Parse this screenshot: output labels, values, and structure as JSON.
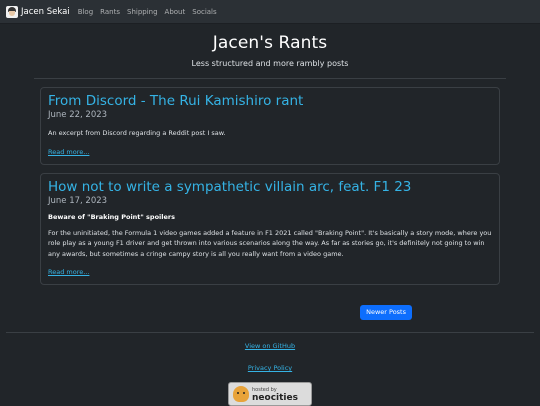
{
  "nav": {
    "brand": "Jacen Sekai",
    "links": [
      "Blog",
      "Rants",
      "Shipping",
      "About",
      "Socials"
    ]
  },
  "header": {
    "title": "Jacen's Rants",
    "subtitle": "Less structured and more rambly posts"
  },
  "posts": [
    {
      "title": "From Discord - The Rui Kamishiro rant",
      "date": "June 22, 2023",
      "excerpt": "An excerpt from Discord regarding a Reddit post I saw.",
      "read_more": "Read more..."
    },
    {
      "title": "How not to write a sympathetic villain arc, feat. F1 23",
      "date": "June 17, 2023",
      "warning": "Beware of \"Braking Point\" spoilers",
      "excerpt": "For the uninitiated, the Formula 1 video games added a feature in F1 2021 called \"Braking Point\". It's basically a story mode, where you role play as a young F1 driver and get thrown into various scenarios along the way. As far as stories go, it's definitely not going to win any awards, but sometimes a cringe campy story is all you really want from a video game.",
      "read_more": "Read more..."
    }
  ],
  "pagination": {
    "newer": "Newer Posts"
  },
  "footer": {
    "github": "View on GitHub",
    "privacy": "Privacy Policy",
    "badge_small": "hosted by",
    "badge_big": "neocities"
  },
  "colors": {
    "accent": "#35b3e5",
    "button": "#0d6efd",
    "background": "#212529"
  }
}
